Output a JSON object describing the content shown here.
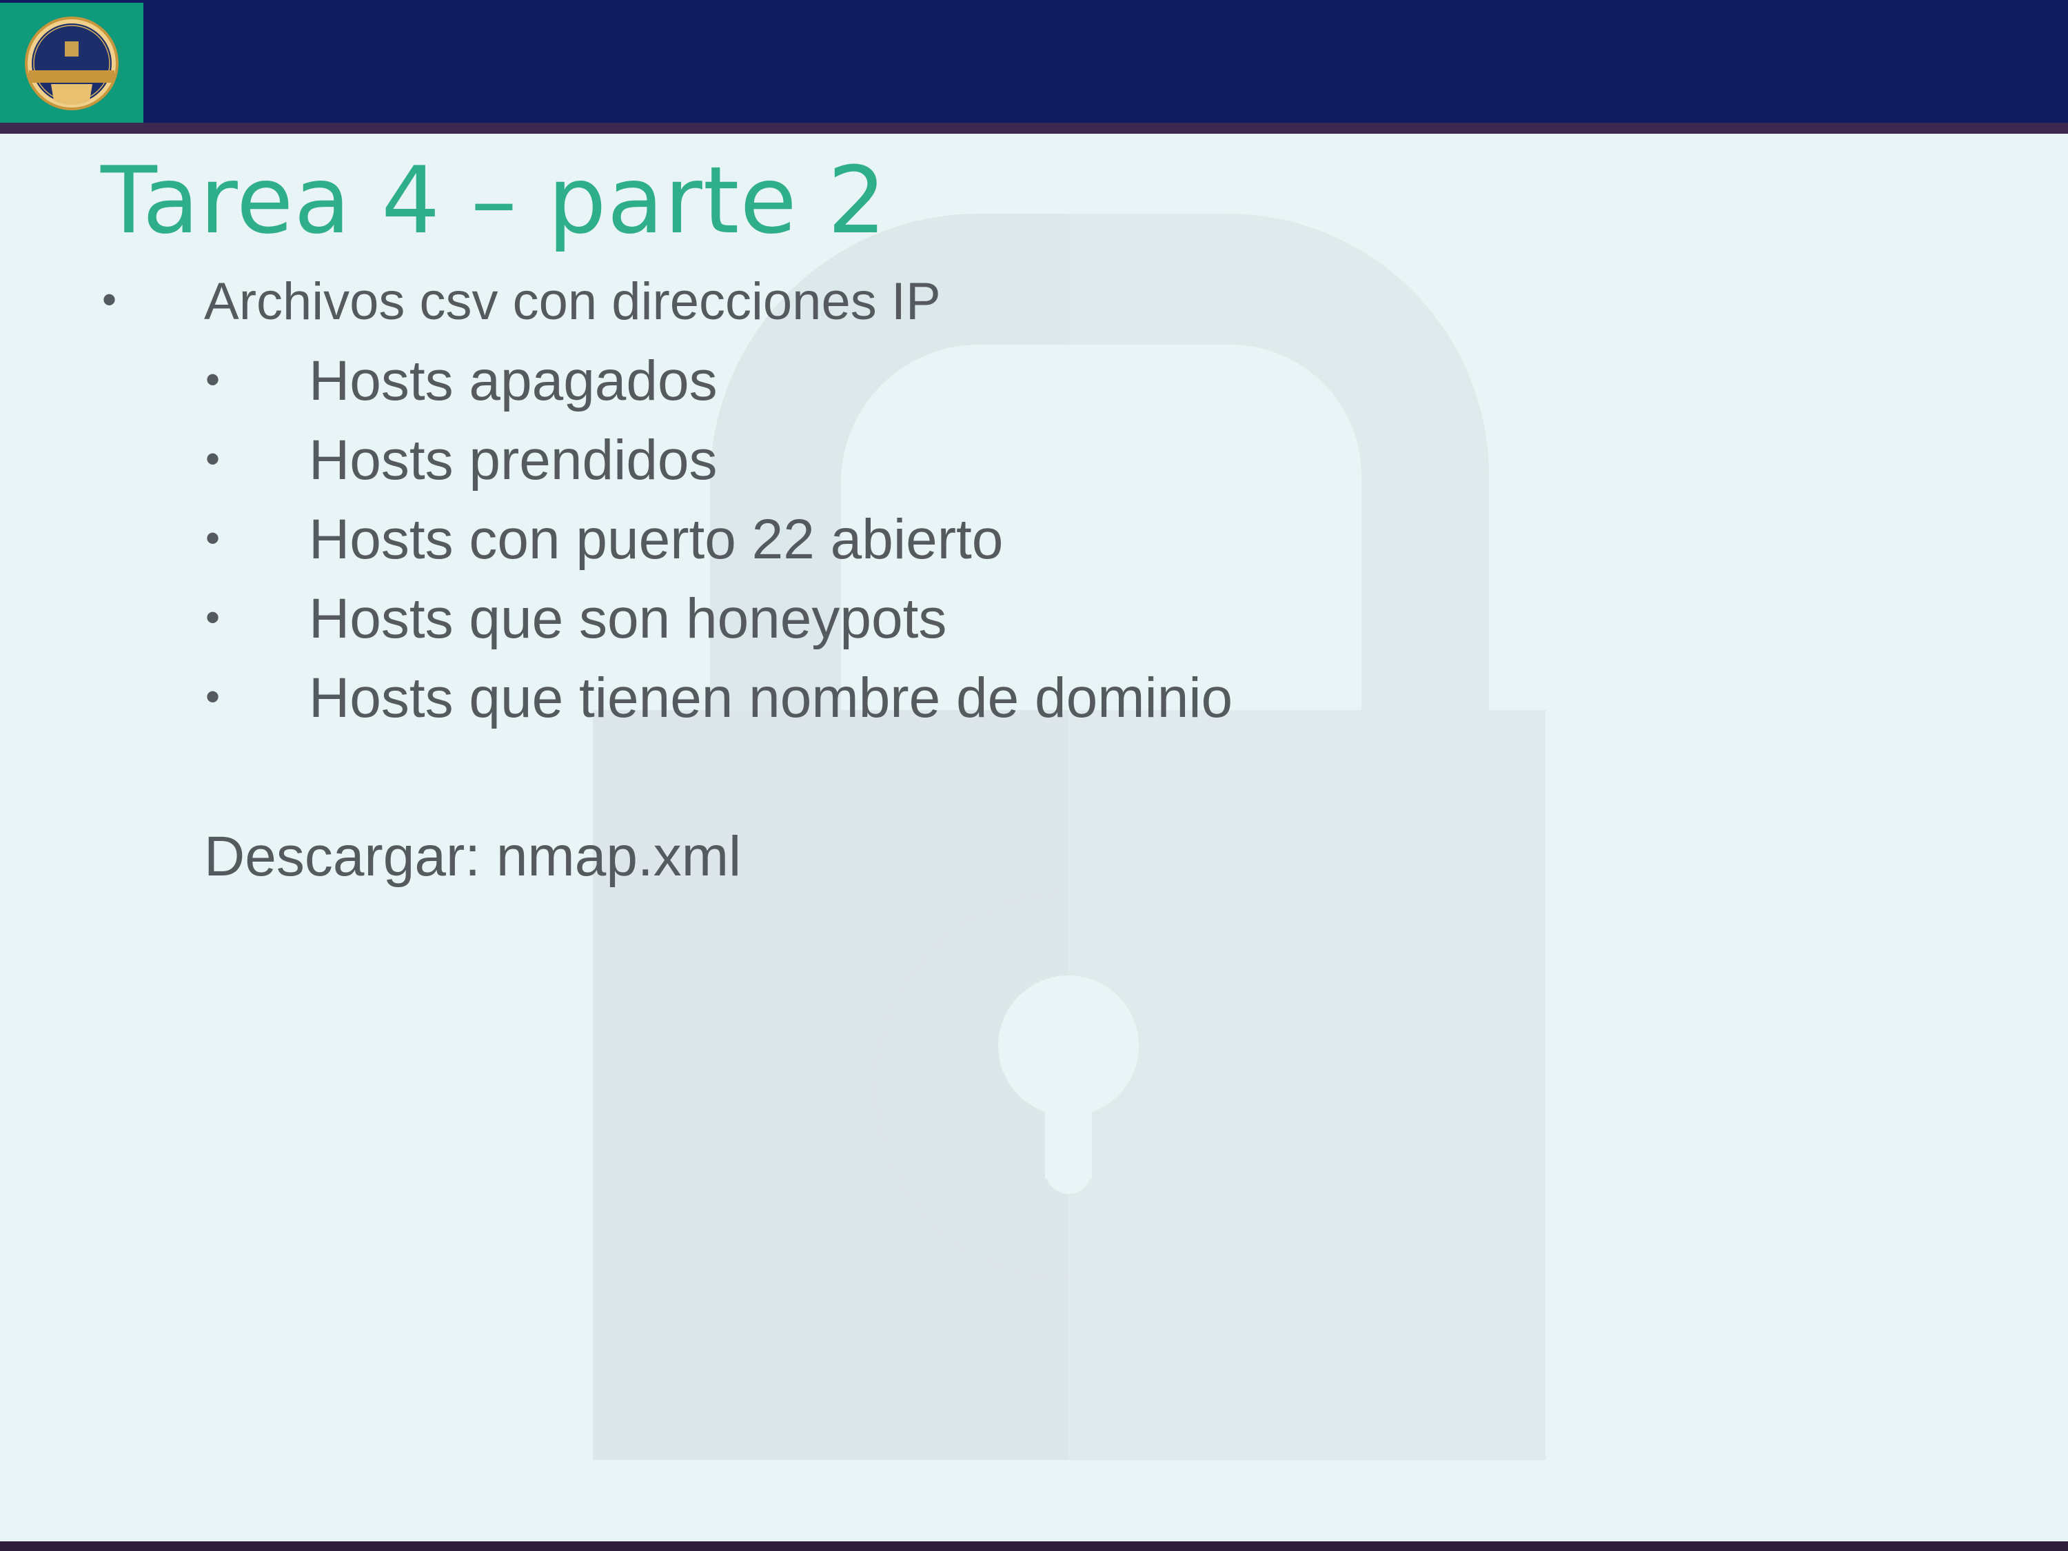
{
  "header": {
    "logo": {
      "alt": "Programa de Becas de Formación en TIC",
      "text_top": "programa de BECAS",
      "text_ribbon": "de FORMACIÓN en",
      "text_bottom": "TIC"
    },
    "colors": {
      "header_bar": "#111c60",
      "logo_box": "#109a7c",
      "rule": "#3d2850"
    }
  },
  "watermark": {
    "icon": "padlock-icon"
  },
  "slide": {
    "title": "Tarea 4 – parte 2",
    "bullets": [
      {
        "text": "Archivos csv con direcciones IP",
        "sub": [
          "Hosts apagados",
          "Hosts prendidos",
          "Hosts con puerto 22 abierto",
          "Hosts que son honeypots",
          "Hosts que tienen nombre de dominio"
        ]
      }
    ],
    "download_label": "Descargar: nmap.xml",
    "bullet_symbol": "•"
  },
  "colors": {
    "background": "#e8f4f5",
    "title": "#2fae8a",
    "body_text": "#555a5e"
  }
}
